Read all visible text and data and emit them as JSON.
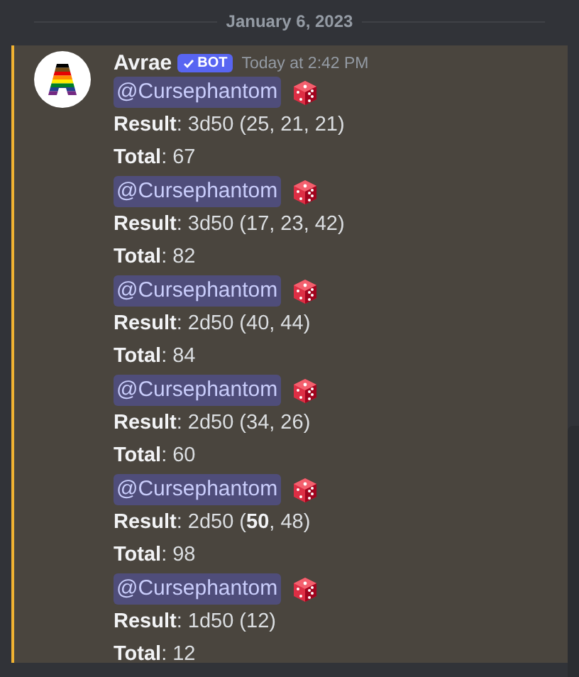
{
  "date_divider": "January 6, 2023",
  "message": {
    "author": "Avrae",
    "badge": "BOT",
    "timestamp": "Today at 2:42 PM",
    "rolls": [
      {
        "mention": "@Cursephantom",
        "result": "**Result**: 3d50 (25, 21, 21)",
        "total": "**Total**: 67"
      },
      {
        "mention": "@Cursephantom",
        "result": "**Result**: 3d50 (17, 23, 42)",
        "total": "**Total**: 82"
      },
      {
        "mention": "@Cursephantom",
        "result": "**Result**: 2d50 (40, 44)",
        "total": "**Total**: 84"
      },
      {
        "mention": "@Cursephantom",
        "result": "**Result**: 2d50 (34, 26)",
        "total": "**Total**: 60"
      },
      {
        "mention": "@Cursephantom",
        "result": "**Result**: 2d50 (**50**, 48)",
        "total": "**Total**: 98"
      },
      {
        "mention": "@Cursephantom",
        "result": "**Result**: 1d50 (12)",
        "total": "**Total**: 12"
      }
    ]
  }
}
